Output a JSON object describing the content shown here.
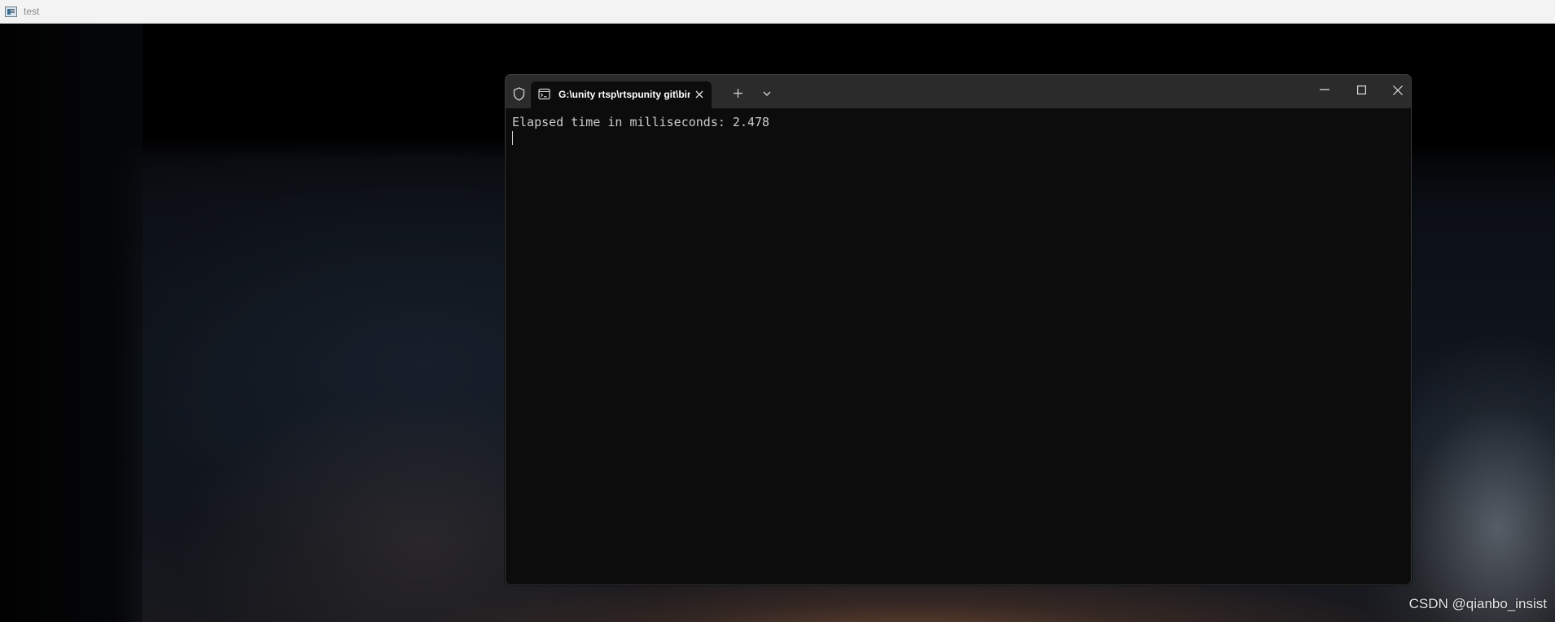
{
  "app_window": {
    "title": "test",
    "icon": "app-window-icon"
  },
  "terminal": {
    "tab": {
      "icon": "console-icon",
      "title": "G:\\unity rtsp\\rtspunity git\\bin"
    },
    "controls": {
      "shield": "shield-icon",
      "new_tab": "plus-icon",
      "dropdown": "chevron-down-icon",
      "minimize": "minimize-icon",
      "maximize": "maximize-icon",
      "close": "close-icon"
    },
    "output_lines": [
      "Elapsed time in milliseconds: 2.478"
    ]
  },
  "watermark": "CSDN @qianbo_insist"
}
